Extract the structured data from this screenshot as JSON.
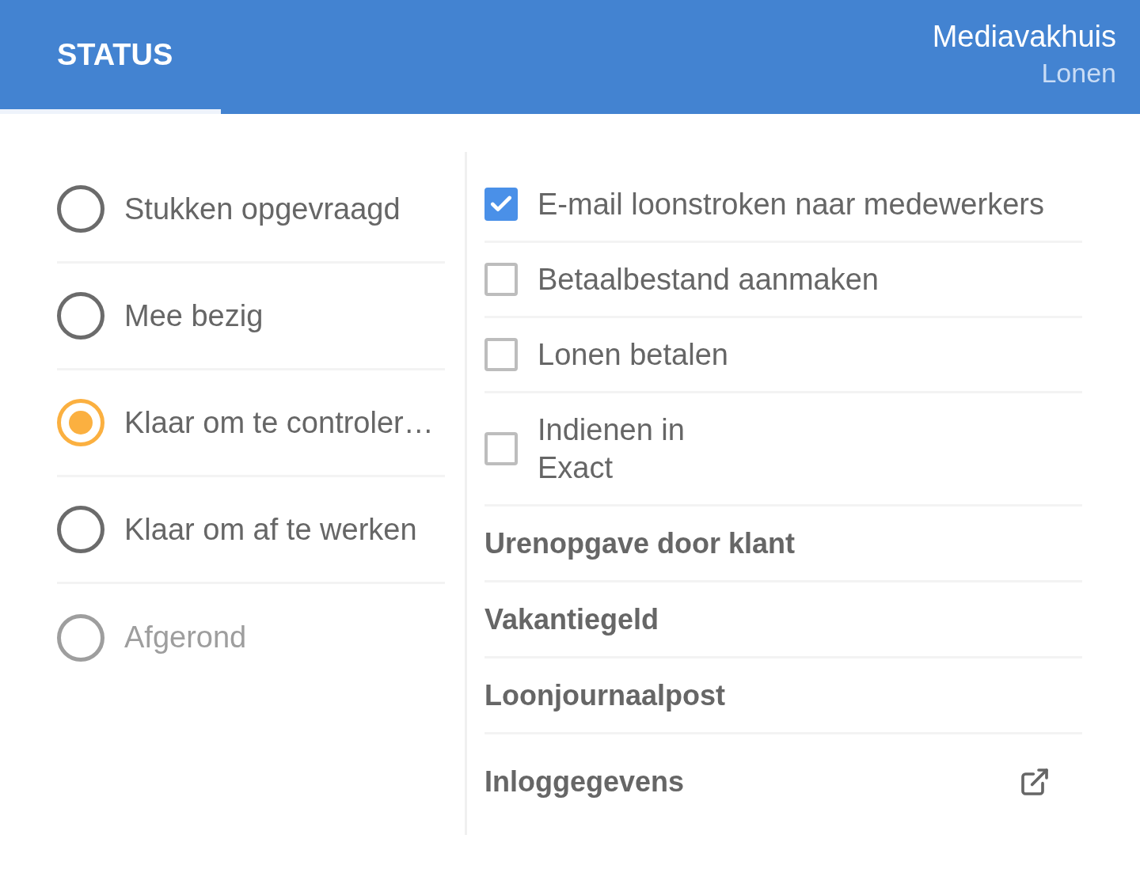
{
  "header": {
    "tabs": [
      {
        "label": "STATUS",
        "selected": true
      }
    ],
    "company": "Mediavakhuis",
    "module": "Lonen"
  },
  "statuses": [
    {
      "label": "Stukken opgevraagd",
      "selected": false,
      "disabled": false
    },
    {
      "label": "Mee bezig",
      "selected": false,
      "disabled": false
    },
    {
      "label": "Klaar om te controler…",
      "selected": true,
      "disabled": false
    },
    {
      "label": "Klaar om af te werken",
      "selected": false,
      "disabled": false
    },
    {
      "label": "Afgerond",
      "selected": false,
      "disabled": true
    }
  ],
  "tasks": [
    {
      "kind": "checkbox",
      "label": "E-mail loonstroken naar medewerkers",
      "checked": true
    },
    {
      "kind": "checkbox",
      "label": "Betaalbestand aanmaken",
      "checked": false
    },
    {
      "kind": "checkbox",
      "label": "Lonen betalen",
      "checked": false
    },
    {
      "kind": "checkbox",
      "label": "Indienen in\nExact",
      "checked": false
    },
    {
      "kind": "section",
      "label": "Urenopgave door klant"
    },
    {
      "kind": "section",
      "label": "Vakantiegeld"
    },
    {
      "kind": "section",
      "label": "Loonjournaalpost"
    },
    {
      "kind": "external",
      "label": "Inloggegevens"
    }
  ]
}
